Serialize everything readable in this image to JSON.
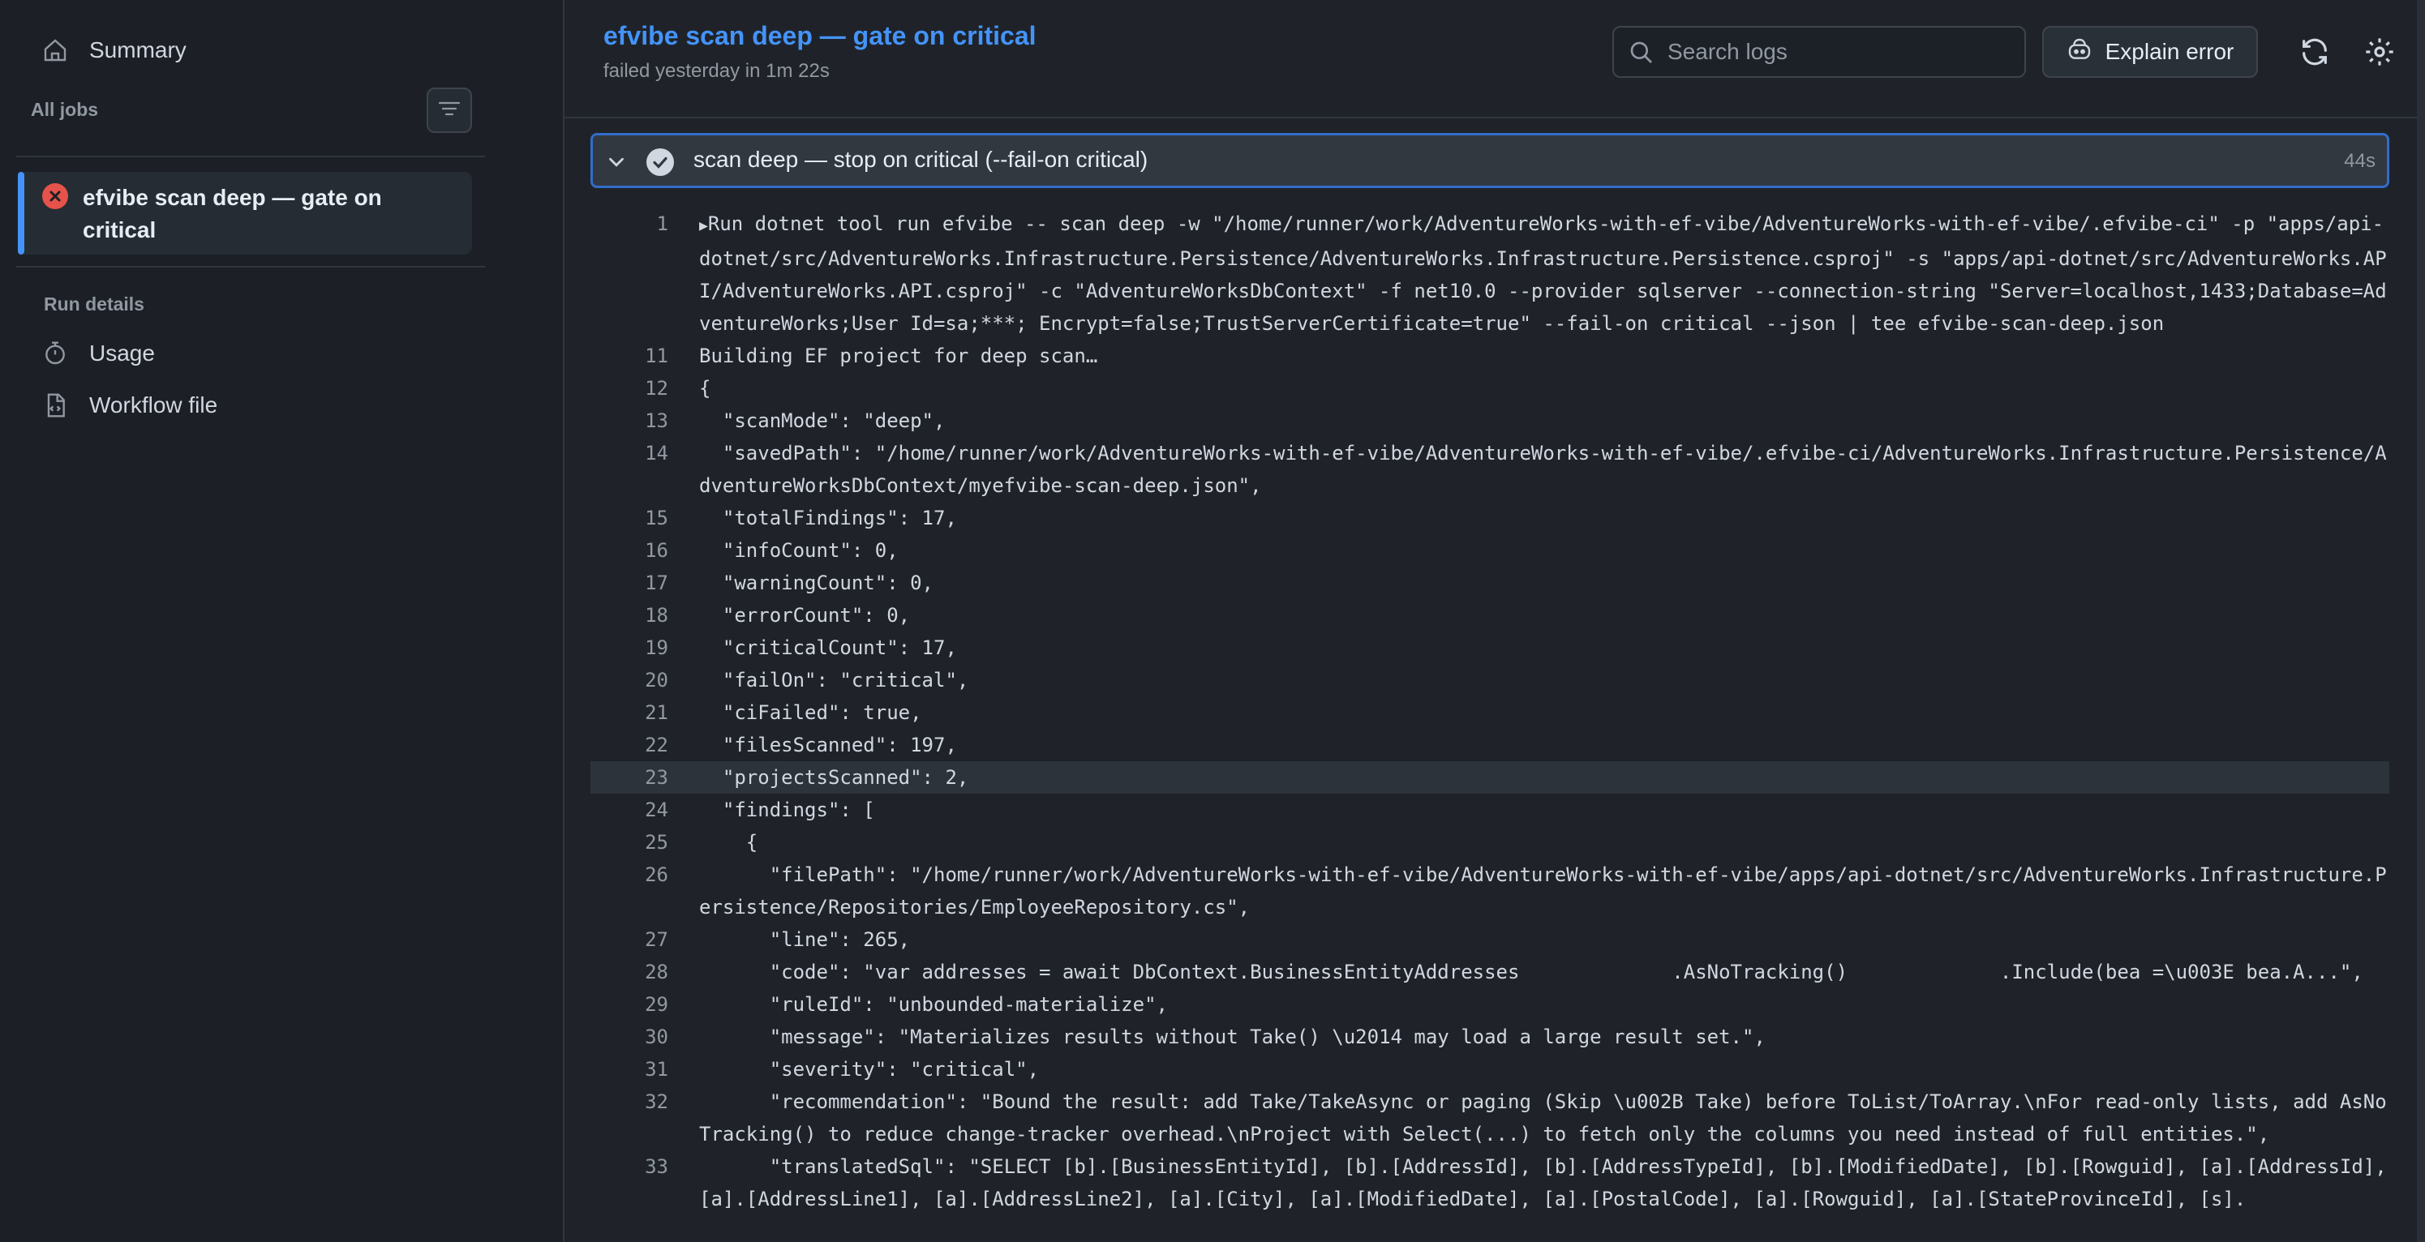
{
  "sidebar": {
    "summary": "Summary",
    "all_jobs": "All jobs",
    "job": "efvibe scan deep — gate on critical",
    "run_details": "Run details",
    "usage": "Usage",
    "workflow_file": "Workflow file"
  },
  "header": {
    "title": "efvibe scan deep — gate on critical",
    "subtitle": "failed yesterday in 1m 22s",
    "search_placeholder": "Search logs",
    "explain": "Explain error"
  },
  "step": {
    "title": "scan deep — stop on critical (--fail-on critical)",
    "duration": "44s"
  },
  "log": [
    {
      "n": "1",
      "t": "Run dotnet tool run efvibe -- scan deep -w \"/home/runner/work/AdventureWorks-with-ef-vibe/AdventureWorks-with-ef-vibe/.efvibe-ci\" -p \"apps/api-dotnet/src/AdventureWorks.Infrastructure.Persistence/AdventureWorks.Infrastructure.Persistence.csproj\" -s \"apps/api-dotnet/src/AdventureWorks.API/AdventureWorks.API.csproj\" -c \"AdventureWorksDbContext\" -f net10.0 --provider sqlserver --connection-string \"Server=localhost,1433;Database=AdventureWorks;User Id=sa;***; Encrypt=false;TrustServerCertificate=true\" --fail-on critical --json | tee efvibe-scan-deep.json"
    },
    {
      "n": "11",
      "t": "Building EF project for deep scan…"
    },
    {
      "n": "12",
      "t": "{"
    },
    {
      "n": "13",
      "t": "  \"scanMode\": \"deep\","
    },
    {
      "n": "14",
      "t": "  \"savedPath\": \"/home/runner/work/AdventureWorks-with-ef-vibe/AdventureWorks-with-ef-vibe/.efvibe-ci/AdventureWorks.Infrastructure.Persistence/AdventureWorksDbContext/myefvibe-scan-deep.json\","
    },
    {
      "n": "15",
      "t": "  \"totalFindings\": 17,"
    },
    {
      "n": "16",
      "t": "  \"infoCount\": 0,"
    },
    {
      "n": "17",
      "t": "  \"warningCount\": 0,"
    },
    {
      "n": "18",
      "t": "  \"errorCount\": 0,"
    },
    {
      "n": "19",
      "t": "  \"criticalCount\": 17,"
    },
    {
      "n": "20",
      "t": "  \"failOn\": \"critical\","
    },
    {
      "n": "21",
      "t": "  \"ciFailed\": true,"
    },
    {
      "n": "22",
      "t": "  \"filesScanned\": 197,"
    },
    {
      "n": "23",
      "t": "  \"projectsScanned\": 2,"
    },
    {
      "n": "24",
      "t": "  \"findings\": ["
    },
    {
      "n": "25",
      "t": "    {"
    },
    {
      "n": "26",
      "t": "      \"filePath\": \"/home/runner/work/AdventureWorks-with-ef-vibe/AdventureWorks-with-ef-vibe/apps/api-dotnet/src/AdventureWorks.Infrastructure.Persistence/Repositories/EmployeeRepository.cs\","
    },
    {
      "n": "27",
      "t": "      \"line\": 265,"
    },
    {
      "n": "28",
      "t": "      \"code\": \"var addresses = await DbContext.BusinessEntityAddresses             .AsNoTracking()             .Include(bea =\\u003E bea.A...\","
    },
    {
      "n": "29",
      "t": "      \"ruleId\": \"unbounded-materialize\","
    },
    {
      "n": "30",
      "t": "      \"message\": \"Materializes results without Take() \\u2014 may load a large result set.\","
    },
    {
      "n": "31",
      "t": "      \"severity\": \"critical\","
    },
    {
      "n": "32",
      "t": "      \"recommendation\": \"Bound the result: add Take/TakeAsync or paging (Skip \\u002B Take) before ToList/ToArray.\\nFor read-only lists, add AsNoTracking() to reduce change-tracker overhead.\\nProject with Select(...) to fetch only the columns you need instead of full entities.\","
    },
    {
      "n": "33",
      "t": "      \"translatedSql\": \"SELECT [b].[BusinessEntityId], [b].[AddressId], [b].[AddressTypeId], [b].[ModifiedDate], [b].[Rowguid], [a].[AddressId], [a].[AddressLine1], [a].[AddressLine2], [a].[City], [a].[ModifiedDate], [a].[PostalCode], [a].[Rowguid], [a].[StateProvinceId], [s]."
    }
  ]
}
